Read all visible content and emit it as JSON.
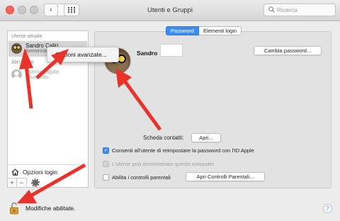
{
  "window": {
    "title": "Utenti e Gruppi"
  },
  "toolbar": {
    "back_glyph": "‹",
    "forward_glyph": "›",
    "search_placeholder": "Ricerca"
  },
  "sidebar": {
    "current_header": "Utente attuale",
    "current_user": {
      "name": "Sandro Caliri",
      "role": "Amministratore"
    },
    "others_header": "Altri utenti",
    "other_users": [
      {
        "name": "Utente ospite",
        "sub": "Disattivato"
      }
    ],
    "login_options": "Opzioni login",
    "add_glyph": "+",
    "remove_glyph": "−"
  },
  "context_menu": {
    "item": "Opzioni avanzate..."
  },
  "tabs": [
    {
      "label": "Password"
    },
    {
      "label": "Elementi login"
    }
  ],
  "profile": {
    "name": "Sandro",
    "change_password": "Cambia password..."
  },
  "contact": {
    "label": "Scheda contatti:",
    "open": "Apri..."
  },
  "options": {
    "reset_with_apple_id": "Consenti all'utente di reimpostare la password con l'ID Apple",
    "can_administer": "L'utente può amministrare questo computer",
    "parental": "Abilita i controlli parentali",
    "open_parental": "Apri Controlli Parentali..."
  },
  "footer": {
    "lock_text": "Modifiche abilitate.",
    "help": "?"
  },
  "colors": {
    "accent": "#3b8ef0",
    "arrow": "#e8322a"
  },
  "icons": [
    "search-icon",
    "grid-icon",
    "house-icon",
    "gear-icon",
    "lock-open-icon",
    "help-icon"
  ]
}
